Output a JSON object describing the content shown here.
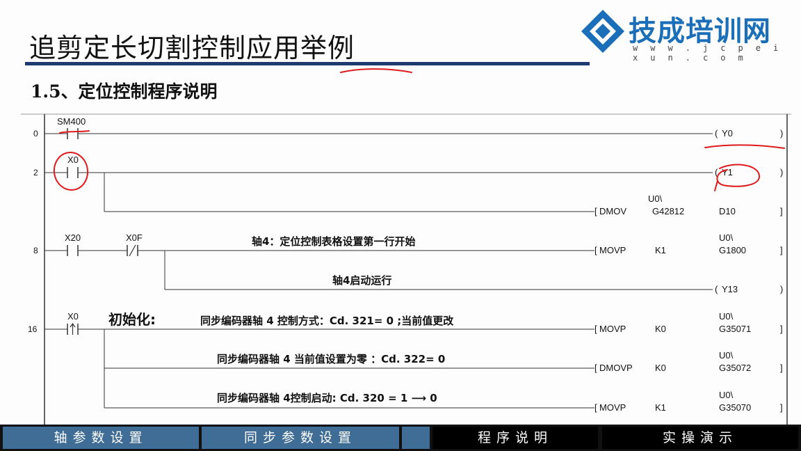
{
  "header": {
    "title": "追剪定长切割控制应用举例",
    "subtitle": "1.5、定位控制程序说明"
  },
  "logo": {
    "name": "技成培训网",
    "url": "w w w . j c p e i x u n . c o m"
  },
  "ladder": {
    "step_numbers": [
      "0",
      "2",
      "8",
      "16"
    ],
    "contacts": {
      "sm400": "SM400",
      "x0": "X0",
      "x20": "X20",
      "x0f": "X0F",
      "x0_pulse": "X0"
    },
    "coils": {
      "y0": "Y0",
      "y1": "Y1",
      "y13": "Y13"
    },
    "instructions": [
      {
        "op": "DMOV",
        "src": "G42812",
        "dst": "D10",
        "dst_prefix": "U0\\"
      },
      {
        "op": "MOVP",
        "src": "K1",
        "dst_prefix": "U0\\",
        "dst": "G1800"
      },
      {
        "op": "MOVP",
        "src": "K0",
        "dst_prefix": "U0\\",
        "dst": "G35071"
      },
      {
        "op": "DMOVP",
        "src": "K0",
        "dst_prefix": "U0\\",
        "dst": "G35072"
      },
      {
        "op": "MOVP",
        "src": "K1",
        "dst_prefix": "U0\\",
        "dst": "G35070"
      }
    ],
    "comments": {
      "axis4_table": "轴4：定位控制表格设置第一行开始",
      "axis4_start": "轴4启动运行",
      "init": "初始化:",
      "enc_mode": "同步编码器轴 4 控制方式：Cd. 321= 0 ;当前值更改",
      "enc_zero": "同步编码器轴 4 当前值设置为零 ：Cd. 322= 0",
      "enc_start": "同步编码器轴 4控制启动:  Cd. 320 = 1 ⟶ 0"
    }
  },
  "nav": {
    "items": [
      {
        "label": "轴参数设置"
      },
      {
        "label": "同步参数设置"
      },
      {
        "label": "程序说明"
      },
      {
        "label": "实操演示"
      }
    ]
  },
  "colors": {
    "title_bar": "#1e3a6e",
    "logo_blue": "#1b6fb8",
    "nav_blue": "#3f6d95",
    "annotation_red": "#e0191b"
  }
}
